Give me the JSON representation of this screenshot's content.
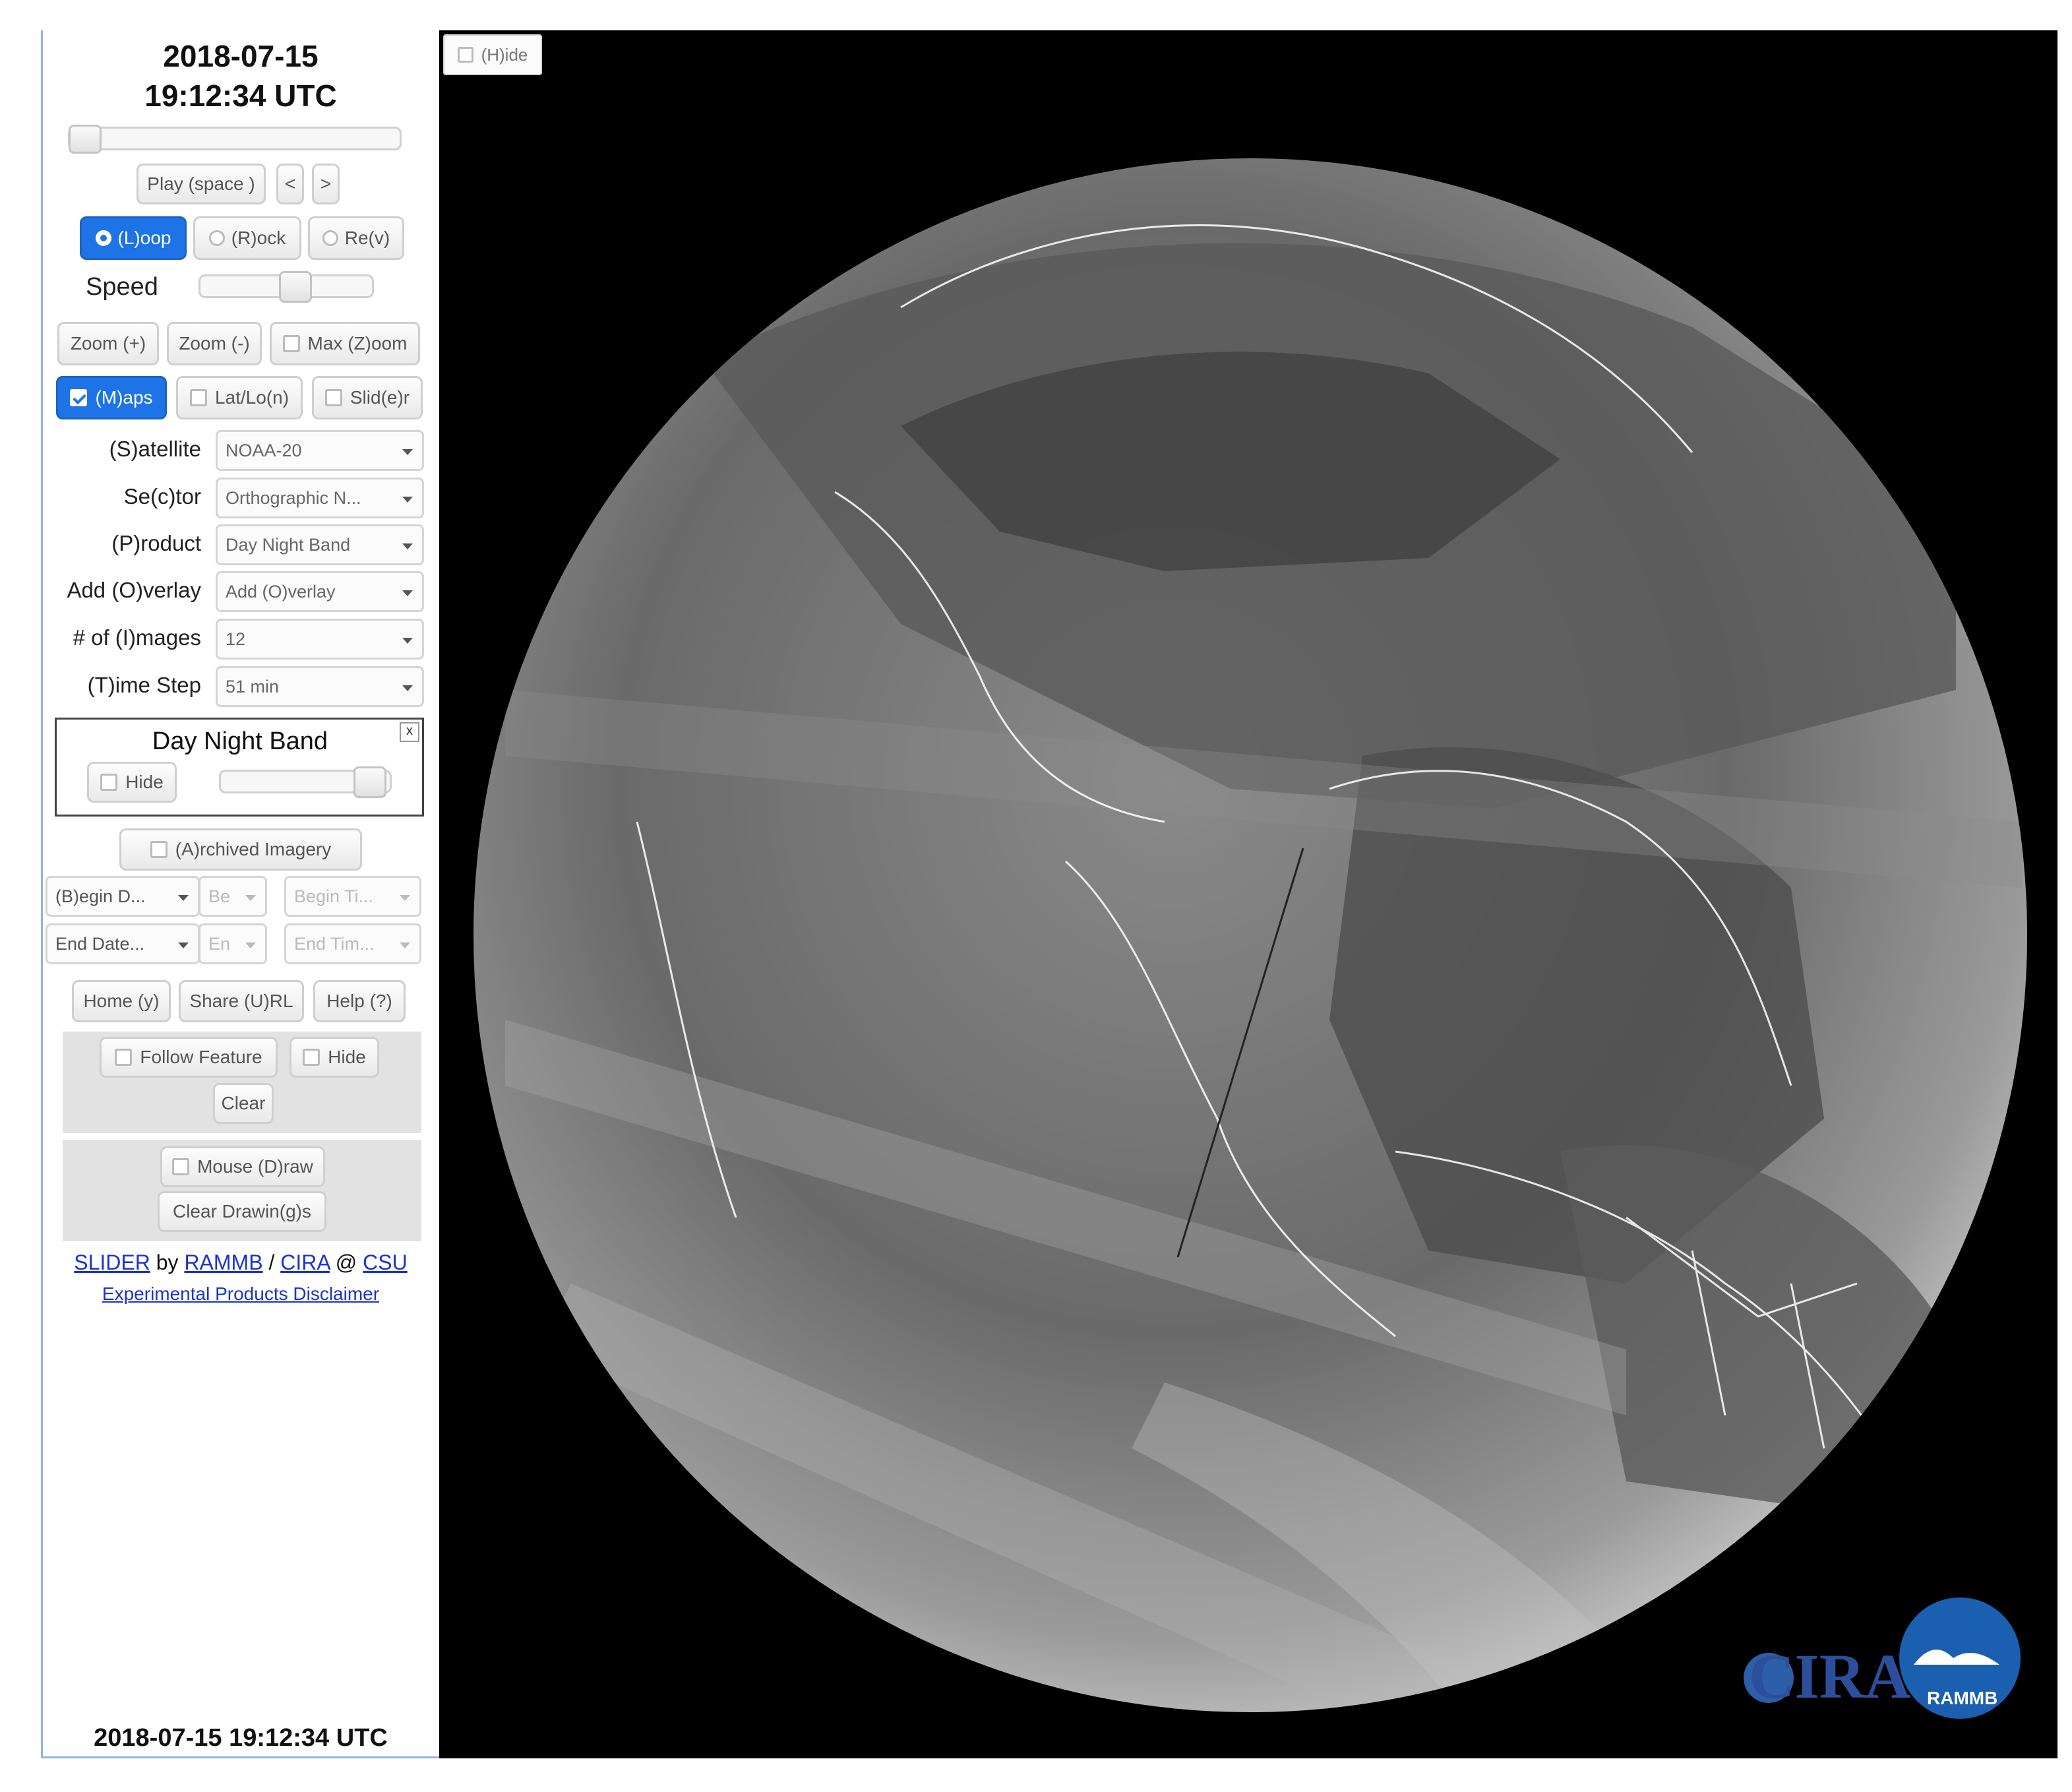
{
  "header": {
    "date": "2018-07-15",
    "time": "19:12:34 UTC"
  },
  "playback": {
    "play_label": "Play (space )",
    "prev_label": "<",
    "next_label": ">"
  },
  "mode": {
    "loop_label": "(L)oop",
    "rock_label": "(R)ock",
    "rev_label": "Re(v)",
    "selected": "loop"
  },
  "speed": {
    "label": "Speed",
    "level": 0.55
  },
  "zoom": {
    "zoom_in": "Zoom (+)",
    "zoom_out": "Zoom (-)",
    "max_zoom": "Max (Z)oom"
  },
  "toggles": {
    "maps": "(M)aps",
    "maps_checked": true,
    "latlon": "Lat/Lo(n)",
    "slider": "Slid(e)r"
  },
  "fields": [
    {
      "label": "(S)atellite",
      "value": "NOAA-20"
    },
    {
      "label": "Se(c)tor",
      "value": "Orthographic N..."
    },
    {
      "label": "(P)roduct",
      "value": "Day Night Band"
    },
    {
      "label": "Add (O)verlay",
      "value": "Add (O)verlay"
    },
    {
      "label": "# of (I)mages",
      "value": "12"
    },
    {
      "label": "(T)ime Step",
      "value": "51 min"
    }
  ],
  "layer": {
    "title": "Day Night Band",
    "hide_label": "Hide",
    "close_label": "x",
    "opacity": 0.95
  },
  "archive": {
    "label": "(A)rchived Imagery",
    "begin_date": "(B)egin D...",
    "begin_small": "Be",
    "begin_time": "Begin Ti...",
    "end_date": "End Date...",
    "end_small": "En",
    "end_time": "End Tim..."
  },
  "actions": {
    "home": "Home (y)",
    "share": "Share (U)RL",
    "help": "Help (?)"
  },
  "feature": {
    "follow": "Follow Feature",
    "hide": "Hide",
    "clear": "Clear"
  },
  "draw": {
    "mouse_draw": "Mouse (D)raw",
    "clear_drawings": "Clear Drawin(g)s"
  },
  "credits": {
    "slider": "SLIDER",
    "by": "by",
    "rammb": "RAMMB",
    "slash": "/",
    "cira": "CIRA",
    "at": "@",
    "csu": "CSU",
    "disclaimer": "Experimental Products Disclaimer"
  },
  "footer": {
    "timestamp": "2018-07-15 19:12:34 UTC"
  },
  "map": {
    "hide_label": "(H)ide"
  },
  "logo": {
    "cira_text": "CIRA",
    "rammb_text": "RAMMB"
  },
  "colors": {
    "accent": "#1e74e6",
    "link": "#1a32d4",
    "map_bg": "#000000"
  }
}
